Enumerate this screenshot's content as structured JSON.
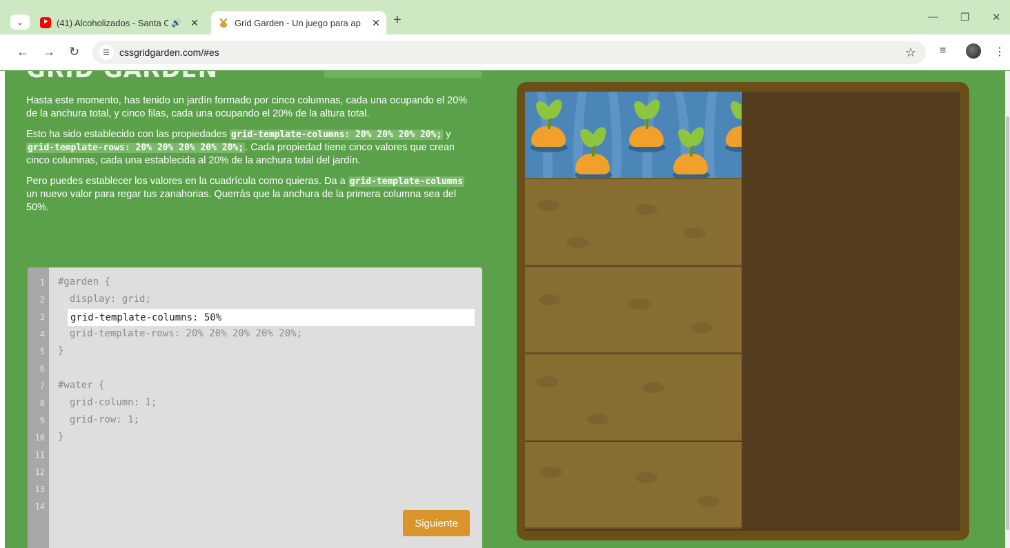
{
  "browser": {
    "tabs": [
      {
        "title": "(41) Alcoholizados - Santa C",
        "icon": "youtube-icon",
        "audio": true
      },
      {
        "title": "Grid Garden - Un juego para ap",
        "icon": "carrot-icon",
        "active": true
      }
    ],
    "url": "cssgridgarden.com/#es"
  },
  "page": {
    "logo": "GRID GARDEN",
    "paragraphs": {
      "p1": "Hasta este momento, has tenido un jardín formado por cinco columnas, cada una ocupando el 20% de la anchura total, y cinco filas, cada una ocupando el 20% de la altura total.",
      "p2_a": "Esto ha sido establecido con las propiedades ",
      "p2_code1": "grid-template-columns: 20% 20% 20% 20%;",
      "p2_b": " y ",
      "p2_code2": "grid-template-rows: 20% 20% 20% 20% 20%;",
      "p2_c": ". Cada propiedad tiene cinco valores que crean cinco columnas, cada una establecida al 20% de la anchura total del jardín.",
      "p3_a": "Pero puedes establecer los valores en la cuadrícula como quieras. Da a ",
      "p3_code": "grid-template-columns",
      "p3_b": " un nuevo valor para regar tus zanahorias. Querrás que la anchura de la primera columna sea del 50%."
    }
  },
  "editor": {
    "line_numbers": [
      "1",
      "2",
      "3",
      "4",
      "5",
      "6",
      "7",
      "8",
      "9",
      "10",
      "11",
      "12",
      "13",
      "14"
    ],
    "lines": {
      "l1": "#garden {",
      "l2": "  display: grid;",
      "l4": "  grid-template-rows: 20% 20% 20% 20% 20%;",
      "l5": "}",
      "l7": "#water {",
      "l8": "  grid-column: 1;",
      "l9": "  grid-row: 1;",
      "l10": "}"
    },
    "input_value": "grid-template-columns: 50%",
    "next_button": "Siguiente"
  },
  "colors": {
    "page_bg": "#5aa14a",
    "button": "#d9952c",
    "water": "#4c85b7",
    "soil": "#886d33"
  }
}
